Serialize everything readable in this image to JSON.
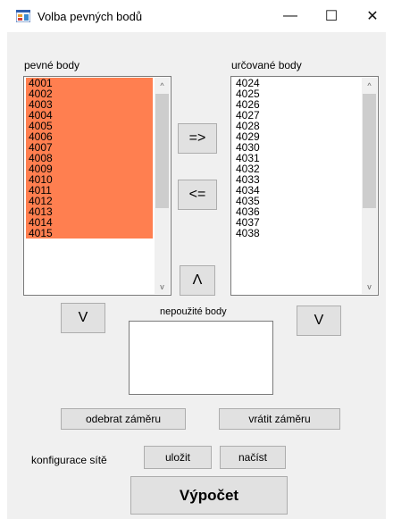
{
  "window": {
    "title": "Volba pevných bodů",
    "minimize_glyph": "—",
    "maximize_glyph": "☐",
    "close_glyph": "✕",
    "app_icon": "form-icon"
  },
  "left_list": {
    "label": "pevné body",
    "items": [
      "4001",
      "4002",
      "4003",
      "4004",
      "4005",
      "4006",
      "4007",
      "4008",
      "4009",
      "4010",
      "4011",
      "4012",
      "4013",
      "4014",
      "4015"
    ],
    "highlight_color": "#ff7f50"
  },
  "right_list": {
    "label": "určované body",
    "items": [
      "4024",
      "4025",
      "4026",
      "4027",
      "4028",
      "4029",
      "4030",
      "4031",
      "4032",
      "4033",
      "4034",
      "4035",
      "4036",
      "4037",
      "4038"
    ]
  },
  "move_right_label": "=>",
  "move_left_label": "<=",
  "up_label": "Λ",
  "left_down_label": "V",
  "right_down_label": "V",
  "unused": {
    "label": "nepoužité body"
  },
  "remove_label": "odebrat záměru",
  "restore_label": "vrátit záměru",
  "config": {
    "label": "konfigurace sítě",
    "save_label": "uložit",
    "load_label": "načíst"
  },
  "compute_label": "Výpočet",
  "scroll_up_glyph": "^",
  "scroll_down_glyph": "v"
}
